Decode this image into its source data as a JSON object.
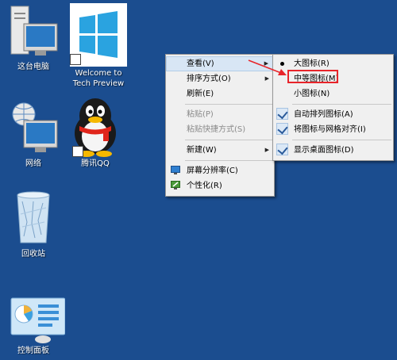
{
  "desktop": {
    "icons": [
      {
        "label": "这台电脑"
      },
      {
        "label": "Welcome to Tech Preview"
      },
      {
        "label": "网络"
      },
      {
        "label": "腾讯QQ"
      },
      {
        "label": "回收站"
      },
      {
        "label": "控制面板"
      }
    ]
  },
  "context_menu": {
    "items": [
      {
        "label": "查看(V)"
      },
      {
        "label": "排序方式(O)"
      },
      {
        "label": "刷新(E)"
      },
      {
        "label": "粘贴(P)"
      },
      {
        "label": "粘贴快捷方式(S)"
      },
      {
        "label": "新建(W)"
      },
      {
        "label": "屏幕分辨率(C)"
      },
      {
        "label": "个性化(R)"
      }
    ]
  },
  "view_submenu": {
    "items": [
      {
        "label": "大图标(R)"
      },
      {
        "label": "中等图标(M)"
      },
      {
        "label": "小图标(N)"
      },
      {
        "label": "自动排列图标(A)"
      },
      {
        "label": "将图标与网格对齐(I)"
      },
      {
        "label": "显示桌面图标(D)"
      }
    ]
  },
  "annotation": {
    "highlight_color": "#e8242a"
  }
}
